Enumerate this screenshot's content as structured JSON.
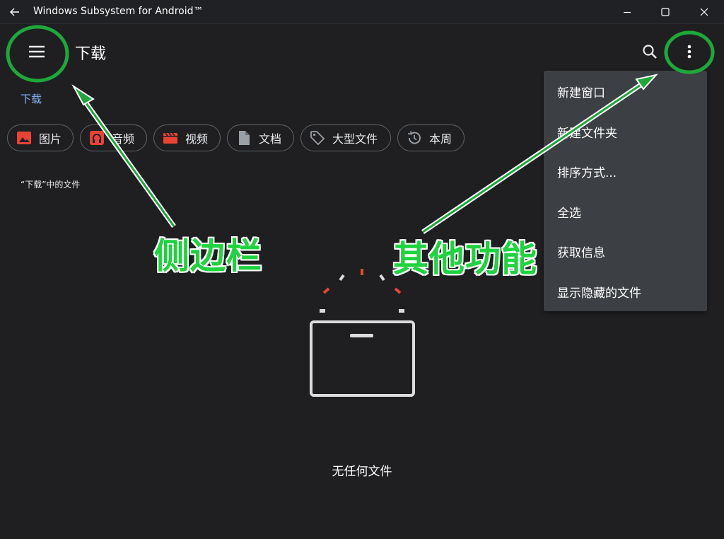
{
  "window": {
    "title": "Windows Subsystem for Android™"
  },
  "appbar": {
    "title": "下载"
  },
  "breadcrumb": {
    "current": "下载"
  },
  "chips": [
    {
      "label": "图片",
      "icon": "image-icon",
      "color": "#ea4335"
    },
    {
      "label": "音频",
      "icon": "audio-icon",
      "color": "#ea4335"
    },
    {
      "label": "视频",
      "icon": "video-icon",
      "color": "#ea4335"
    },
    {
      "label": "文档",
      "icon": "document-icon",
      "color": "#9aa0a6"
    },
    {
      "label": "大型文件",
      "icon": "tag-icon",
      "color": "#9aa0a6"
    },
    {
      "label": "本周",
      "icon": "history-icon",
      "color": "#9aa0a6"
    }
  ],
  "section_label": "“下载”中的文件",
  "empty_state": {
    "text": "无任何文件"
  },
  "overflow_menu": {
    "items": [
      "新建窗口",
      "新建文件夹",
      "排序方式...",
      "全选",
      "获取信息",
      "显示隐藏的文件"
    ]
  },
  "annotations": {
    "sidebar_label": "侧边栏",
    "more_label": "其他功能",
    "color": "#1ed33d"
  }
}
